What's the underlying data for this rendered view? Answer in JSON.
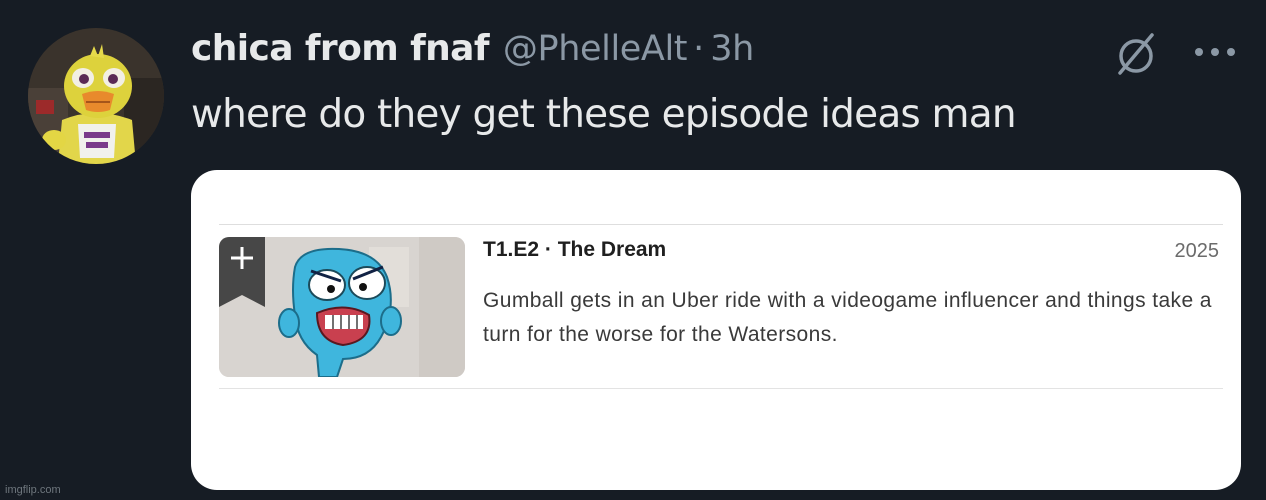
{
  "tweet": {
    "display_name": "chica from fnaf",
    "handle": "@PhelleAlt",
    "separator": "·",
    "time": "3h",
    "text": "where do they get these episode ideas man",
    "avatar_icon": "chica-avatar",
    "grok_icon": "slash-circle-icon",
    "more_icon": "ellipsis-icon"
  },
  "media": {
    "episode_title": "T1.E2 · The Dream",
    "year": "2025",
    "description": "Gumball gets in an Uber ride with a videogame influencer and things take a turn for the worse for the Watersons.",
    "add_icon": "plus-icon"
  },
  "watermark": "imgflip.com",
  "colors": {
    "background": "#161c24",
    "text_primary": "#e7e9ea",
    "text_secondary": "#8b98a5",
    "card": "#ffffff",
    "gumball_blue": "#3fb6dd"
  }
}
